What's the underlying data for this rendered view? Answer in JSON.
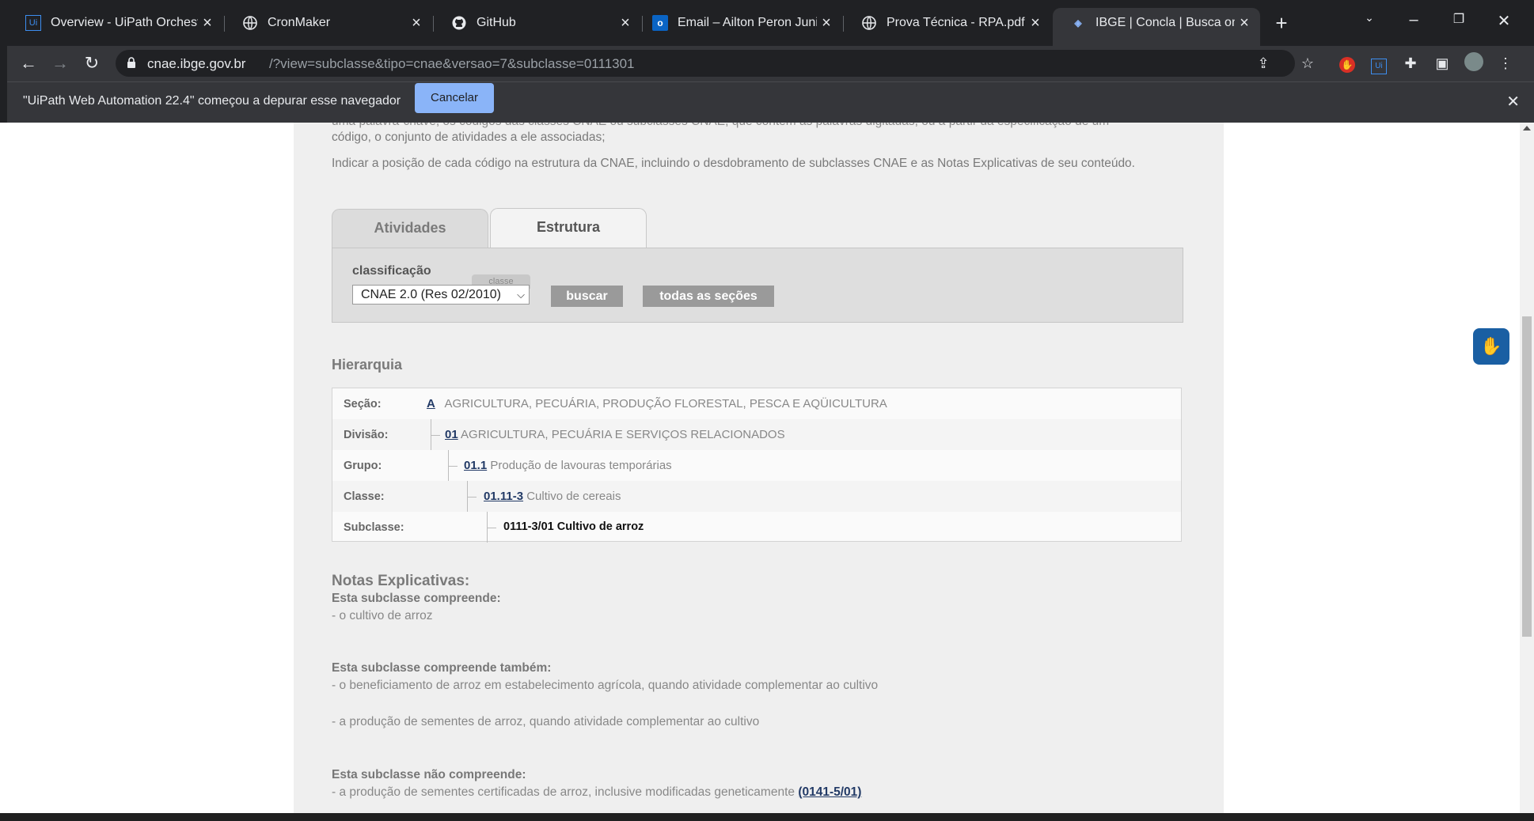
{
  "browser": {
    "tabs": [
      {
        "title": "Overview - UiPath Orchestr",
        "icon": "uipath-icon"
      },
      {
        "title": "CronMaker",
        "icon": "globe-icon"
      },
      {
        "title": "GitHub",
        "icon": "github-icon"
      },
      {
        "title": "Email – Ailton Peron Junior",
        "icon": "outlook-icon"
      },
      {
        "title": "Prova Técnica - RPA.pdf",
        "icon": "globe-icon"
      },
      {
        "title": "IBGE | Concla | Busca online",
        "icon": "ibge-icon",
        "active": true
      }
    ],
    "url_host": "cnae.ibge.gov.br",
    "url_path": "/?view=subclasse&tipo=cnae&versao=7&subclasse=0111301",
    "infobar": {
      "message": "\"UiPath Web Automation 22.4\" começou a depurar esse navegador",
      "cancel_label": "Cancelar"
    }
  },
  "page": {
    "intro_line1": "uma palavra-chave, os códigos das classes CNAE ou subclasses CNAE, que contêm as palavras digitadas, ou a partir da especificação de um",
    "intro_line2": "código, o conjunto de atividades a ele associadas;",
    "intro_line3": "Indicar a posição de cada código na estrutura da CNAE, incluindo o desdobramento de subclasses CNAE e as Notas Explicativas de seu conteúdo.",
    "tabs": {
      "atividades": "Atividades",
      "estrutura": "Estrutura"
    },
    "search": {
      "label": "classificação",
      "classe_tag": "classe",
      "selected": "CNAE 2.0 (Res 02/2010)",
      "buscar": "buscar",
      "todas": "todas as seções"
    },
    "hierarquia": {
      "title": "Hierarquia",
      "rows": [
        {
          "label": "Seção:",
          "code": "A",
          "text": "AGRICULTURA, PECUÁRIA, PRODUÇÃO FLORESTAL, PESCA E AQÜICULTURA"
        },
        {
          "label": "Divisão:",
          "code": "01",
          "text": "AGRICULTURA, PECUÁRIA E SERVIÇOS RELACIONADOS"
        },
        {
          "label": "Grupo:",
          "code": "01.1",
          "text": "Produção de lavouras temporárias"
        },
        {
          "label": "Classe:",
          "code": "01.11-3",
          "text": "Cultivo de cereais"
        },
        {
          "label": "Subclasse:",
          "code": "",
          "text": "0111-3/01 Cultivo de arroz"
        }
      ]
    },
    "notas": {
      "title": "Notas Explicativas:",
      "compreende_title": "Esta subclasse compreende:",
      "compreende_1": "- o cultivo de arroz",
      "tambem_title": "Esta subclasse compreende também:",
      "tambem_1": "- o beneficiamento de arroz em estabelecimento agrícola, quando atividade complementar ao cultivo",
      "tambem_2": "- a produção de sementes de arroz, quando atividade complementar ao cultivo",
      "nao_title": "Esta subclasse não compreende:",
      "nao_1": "- a produção de sementes certificadas de arroz, inclusive modificadas geneticamente",
      "nao_1_link": "(0141-5/01)"
    }
  }
}
